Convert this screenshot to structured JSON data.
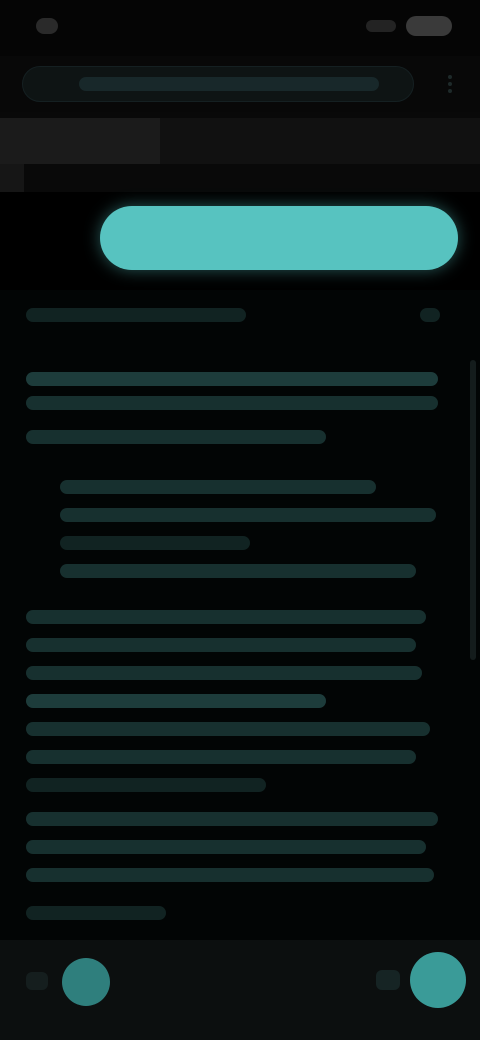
{
  "status_bar": {
    "left_icon": "notification-dot-icon",
    "right_icons": [
      "signal-icon",
      "battery-icon"
    ]
  },
  "browser": {
    "url_icon": "globe-icon",
    "menu_icon": "more-vertical-icon"
  },
  "cta": {
    "label": ""
  },
  "navigation": {
    "back_icon": "arrow-back-icon",
    "forward_icon": "arrow-forward-icon"
  },
  "colors": {
    "accent": "#57c3c0",
    "background": "#000000",
    "text_dim": "#17302f"
  }
}
